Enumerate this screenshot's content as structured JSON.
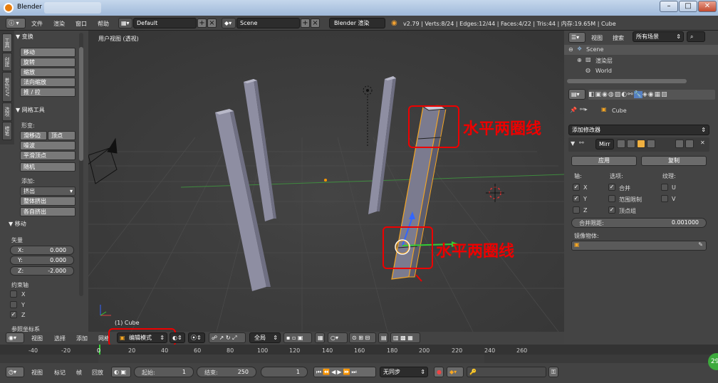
{
  "window": {
    "title": "Blender"
  },
  "info_header": {
    "menus": [
      "文件",
      "渲染",
      "窗口",
      "帮助"
    ],
    "layout": "Default",
    "scene": "Scene",
    "engine": "Blender 渲染",
    "stats": "v2.79 | Verts:8/24 | Edges:12/44 | Faces:4/22 | Tris:44 | 内存:19.65M | Cube"
  },
  "toolshelf": {
    "tabs": [
      "工具",
      "创建",
      "着色/UV",
      "选项",
      "蜡笔"
    ],
    "transform_title": "变换",
    "transform_buttons": [
      "移动",
      "旋转",
      "缩放",
      "法向缩放",
      "推 / 拉"
    ],
    "mesh_tools_title": "网格工具",
    "deform_label": "形变:",
    "slide_edge": "滑移边",
    "vertex": "顶点",
    "noise": "噪波",
    "smooth_vertex": "平滑顶点",
    "random": "随机",
    "add_label": "添加:",
    "extrude": "挤出",
    "extrude_region": "整体挤出",
    "extrude_individual": "各自挤出"
  },
  "operator": {
    "title": "移动",
    "vector_label": "矢量",
    "x_label": "X:",
    "x_value": "0.000",
    "y_label": "Y:",
    "y_value": "0.000",
    "z_label": "Z:",
    "z_value": "-2.000",
    "constraint_label": "约束轴",
    "axes": [
      {
        "name": "X",
        "checked": false
      },
      {
        "name": "Y",
        "checked": false
      },
      {
        "name": "Z",
        "checked": true
      }
    ],
    "orientation_label": "参照坐标系"
  },
  "viewport": {
    "view_name": "用户视图 (透视)",
    "object_label": "(1) Cube",
    "annotation_1": "水平两圈线",
    "annotation_2": "水平两圈线"
  },
  "viewport_header": {
    "menus": [
      "视图",
      "选择",
      "添加",
      "网格"
    ],
    "mode": "编辑模式",
    "pivot": "全局"
  },
  "timeline": {
    "ticks": [
      "-40",
      "-20",
      "0",
      "20",
      "40",
      "60",
      "80",
      "100",
      "120",
      "140",
      "160",
      "180",
      "200",
      "220",
      "240",
      "260"
    ],
    "current_frame_tick": "0"
  },
  "timeline_header": {
    "menus": [
      "视图",
      "标记",
      "帧",
      "回放"
    ],
    "start_label": "起始:",
    "start_value": "1",
    "end_label": "结束:",
    "end_value": "250",
    "current": "1",
    "sync": "无同步"
  },
  "outliner": {
    "menus": [
      "视图",
      "搜索"
    ],
    "filter": "所有场景",
    "items": [
      {
        "label": "Scene",
        "level": 0
      },
      {
        "label": "渲染层",
        "level": 1
      },
      {
        "label": "World",
        "level": 1
      }
    ]
  },
  "properties": {
    "context_object": "Cube",
    "add_modifier": "添加修改器",
    "modifier_name": "Mirr",
    "apply": "应用",
    "copy": "复制",
    "axis_header": "轴:",
    "options_header": "选项:",
    "texture_header": "纹理:",
    "axis": [
      {
        "name": "X",
        "checked": true
      },
      {
        "name": "Y",
        "checked": true
      },
      {
        "name": "Z",
        "checked": false
      }
    ],
    "options": [
      {
        "name": "合并",
        "checked": true
      },
      {
        "name": "范围限制",
        "checked": false
      },
      {
        "name": "顶点组",
        "checked": true
      }
    ],
    "texture": [
      {
        "name": "U",
        "checked": false
      },
      {
        "name": "V",
        "checked": false
      }
    ],
    "merge_limit_label": "合并限距:",
    "merge_limit_value": "0.001000",
    "mirror_object_label": "镜像物体:"
  },
  "corner_badge": "29",
  "colors": {
    "annotation": "#e00000",
    "selection": "#f5a623",
    "x_axis": "#d44",
    "y_axis": "#5c5",
    "z_axis": "#36f"
  }
}
